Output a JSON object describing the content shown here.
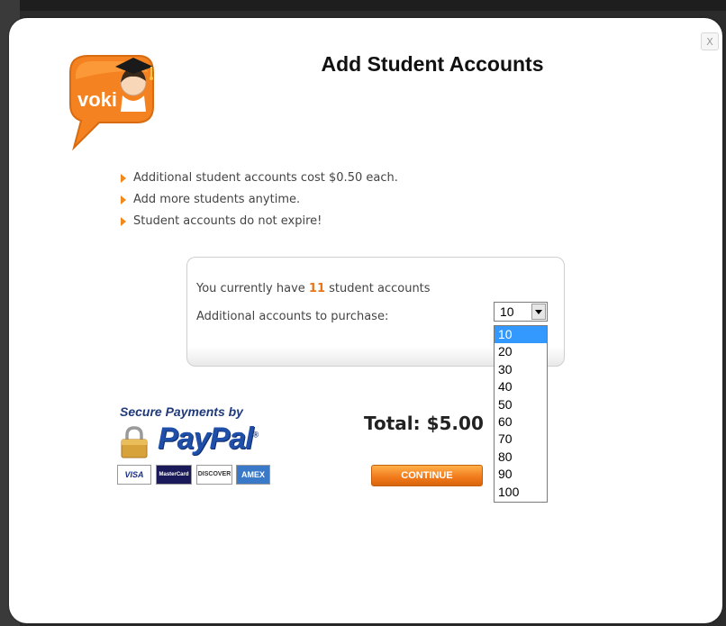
{
  "dialog": {
    "title": "Add Student Accounts",
    "close_label": "X",
    "logo_text": "voki"
  },
  "bullets": [
    "Additional student accounts cost $0.50 each.",
    "Add more students anytime.",
    "Student accounts do not expire!"
  ],
  "account_box": {
    "current_prefix": "You currently have",
    "current_count": "11",
    "current_suffix": "student accounts",
    "purchase_label": "Additional accounts to purchase:",
    "selected_value": "10",
    "options": [
      "10",
      "20",
      "30",
      "40",
      "50",
      "60",
      "70",
      "80",
      "90",
      "100"
    ],
    "highlighted_option": "10"
  },
  "payment": {
    "secure_text": "Secure Payments by",
    "paypal_text": "PayPal",
    "reg_mark": "®",
    "cards": [
      "VISA",
      "MasterCard",
      "DISCOVER",
      "AMEX"
    ]
  },
  "total": {
    "label": "Total: $5.00"
  },
  "continue_label": "CONTINUE",
  "colors": {
    "accent_orange": "#f08a1c",
    "count_orange": "#e8751a",
    "paypal_blue": "#1f4fa8",
    "selection_blue": "#3399ff"
  }
}
